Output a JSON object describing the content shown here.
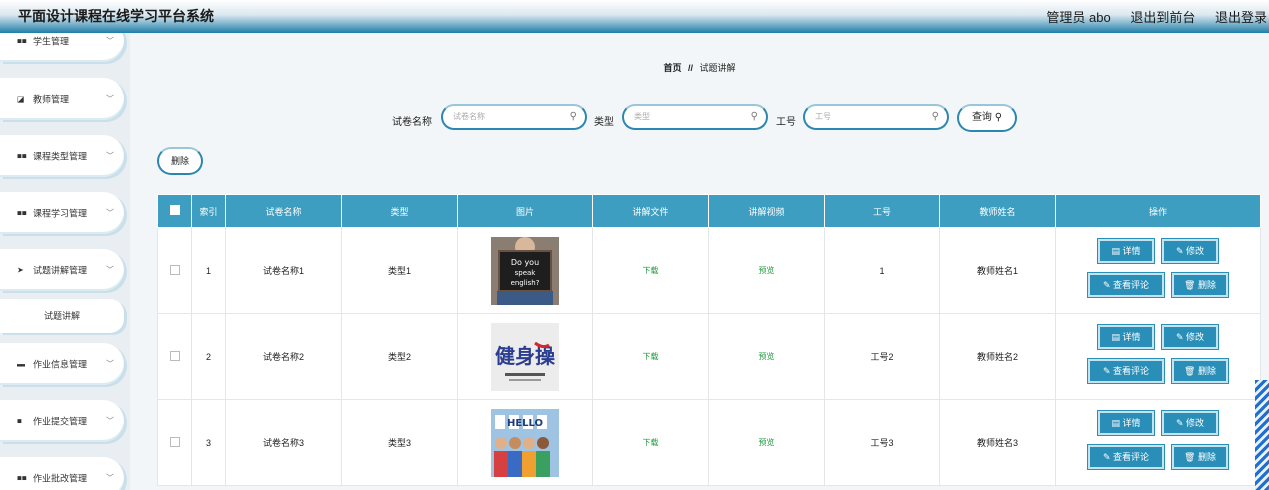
{
  "header": {
    "title": "平面设计课程在线学习平台系统",
    "user": "管理员 abo",
    "back_to_front": "退出到前台",
    "logout": "退出登录"
  },
  "sidebar": {
    "items": [
      {
        "label": "学生管理",
        "icon": "grid-icon"
      },
      {
        "label": "教师管理",
        "icon": "edit-square-icon"
      },
      {
        "label": "课程类型管理",
        "icon": "grid-icon"
      },
      {
        "label": "课程学习管理",
        "icon": "grid-icon"
      },
      {
        "label": "试题讲解管理",
        "icon": "send-icon"
      },
      {
        "label": "作业信息管理",
        "icon": "monitor-icon"
      },
      {
        "label": "作业提交管理",
        "icon": "message-icon"
      },
      {
        "label": "作业批改管理",
        "icon": "grid-icon"
      }
    ],
    "sub_item": "试题讲解"
  },
  "breadcrumb": {
    "home": "首页",
    "sep": "//",
    "current": "试题讲解"
  },
  "search": {
    "name_label": "试卷名称",
    "name_placeholder": "试卷名称",
    "type_label": "类型",
    "type_placeholder": "类型",
    "id_label": "工号",
    "id_placeholder": "工号",
    "query_label": "查询"
  },
  "delete_label": "删除",
  "table": {
    "headers": [
      "索引",
      "试卷名称",
      "类型",
      "图片",
      "讲解文件",
      "讲解视频",
      "工号",
      "教师姓名",
      "操作"
    ],
    "rows": [
      {
        "index": "1",
        "name": "试卷名称1",
        "type": "类型1",
        "file": "下载",
        "video": "预览",
        "id": "1",
        "teacher": "教师姓名1",
        "img_text": "Do you speak english?"
      },
      {
        "index": "2",
        "name": "试卷名称2",
        "type": "类型2",
        "file": "下载",
        "video": "预览",
        "id": "工号2",
        "teacher": "教师姓名2",
        "img_text": "健身操"
      },
      {
        "index": "3",
        "name": "试卷名称3",
        "type": "类型3",
        "file": "下载",
        "video": "预览",
        "id": "工号3",
        "teacher": "教师姓名3",
        "img_text": "HELLO"
      }
    ],
    "ops": {
      "detail": "详情",
      "edit": "修改",
      "comments": "查看评论",
      "delete": "删除"
    }
  },
  "colors": {
    "accent": "#3d9ec1",
    "button": "#2a8fb8",
    "link": "#1a9a3a"
  }
}
